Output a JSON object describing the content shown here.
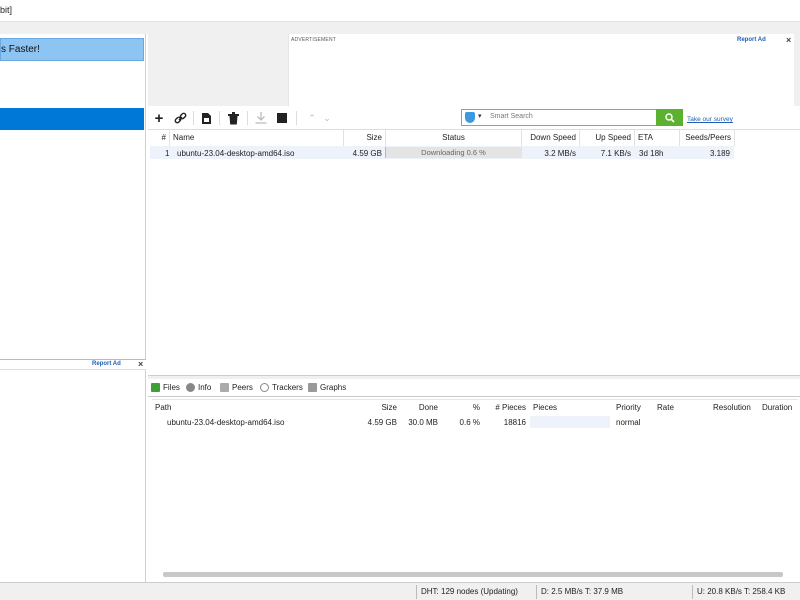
{
  "window": {
    "title_fragment": "bit]"
  },
  "sidebar": {
    "promo_text": "s Faster!",
    "ad": {
      "report_label": "Report Ad",
      "close_label": "×"
    }
  },
  "top_ad": {
    "label": "ADVERTISEMENT",
    "report_label": "Report Ad",
    "close_label": "×"
  },
  "toolbar": {
    "add_icon": "plus-icon",
    "link_icon": "link-icon",
    "create_icon": "new-file-icon",
    "remove_icon": "trash-icon",
    "download_icon": "download-icon",
    "stop_icon": "stop-icon",
    "up_icon": "arrow-up-icon",
    "down_icon": "arrow-down-icon"
  },
  "search": {
    "placeholder": "Smart Search",
    "button_icon": "search-icon",
    "survey_link": "Take our survey"
  },
  "torrent_table": {
    "columns": [
      "#",
      "Name",
      "Size",
      "Status",
      "Down Speed",
      "Up Speed",
      "ETA",
      "Seeds/Peers"
    ],
    "rows": [
      {
        "num": "1",
        "name": "ubuntu-23.04-desktop-amd64.iso",
        "size": "4.59 GB",
        "status": "Downloading 0.6 %",
        "progress": 0.006,
        "down": "3.2 MB/s",
        "up": "7.1 KB/s",
        "eta": "3d 18h",
        "seeds": "3.189"
      }
    ]
  },
  "detail_tabs": [
    "Files",
    "Info",
    "Peers",
    "Trackers",
    "Graphs"
  ],
  "files_table": {
    "columns": [
      "Path",
      "Size",
      "Done",
      "%",
      "# Pieces",
      "Pieces",
      "Priority",
      "Rate",
      "Resolution",
      "Duration"
    ],
    "rows": [
      {
        "path": "ubuntu-23.04-desktop-amd64.iso",
        "size": "4.59 GB",
        "done": "30.0 MB",
        "pct": "0.6 %",
        "pieces_count": "18816",
        "priority": "normal"
      }
    ]
  },
  "status_bar": {
    "dht": "DHT: 129 nodes (Updating)",
    "down": "D: 2.5 MB/s T: 37.9 MB",
    "up": "U: 20.8 KB/s T: 258.4 KB"
  },
  "colors": {
    "accent": "#0078d7",
    "promo": "#8ec4f1",
    "progress": "#9fd37b",
    "search_border": "#7cbf3b"
  }
}
